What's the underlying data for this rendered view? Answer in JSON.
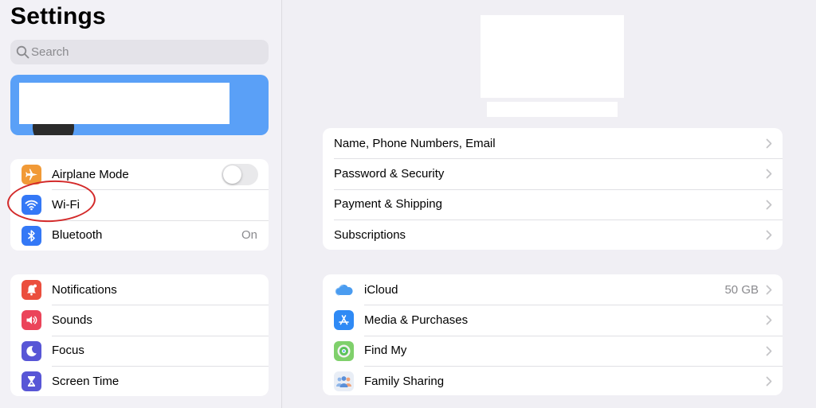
{
  "sidebar": {
    "title": "Settings",
    "search": {
      "placeholder": "Search",
      "value": ""
    },
    "group1": [
      {
        "label": "Airplane Mode",
        "icon": "airplane-icon",
        "color": "#f19a37"
      },
      {
        "label": "Wi-Fi",
        "icon": "wifi-icon",
        "color": "#3478f6"
      },
      {
        "label": "Bluetooth",
        "icon": "bluetooth-icon",
        "color": "#3478f6",
        "value": "On"
      }
    ],
    "group2": [
      {
        "label": "Notifications",
        "icon": "bell-icon",
        "color": "#eb4e3d"
      },
      {
        "label": "Sounds",
        "icon": "speaker-icon",
        "color": "#eb445a"
      },
      {
        "label": "Focus",
        "icon": "moon-icon",
        "color": "#5856d6"
      },
      {
        "label": "Screen Time",
        "icon": "hourglass-icon",
        "color": "#5856d6"
      }
    ]
  },
  "main": {
    "group1": [
      {
        "label": "Name, Phone Numbers, Email"
      },
      {
        "label": "Password & Security"
      },
      {
        "label": "Payment & Shipping"
      },
      {
        "label": "Subscriptions"
      }
    ],
    "group2": [
      {
        "label": "iCloud",
        "icon": "icloud-icon",
        "value": "50 GB"
      },
      {
        "label": "Media & Purchases",
        "icon": "app-store-icon"
      },
      {
        "label": "Find My",
        "icon": "find-my-icon"
      },
      {
        "label": "Family Sharing",
        "icon": "family-sharing-icon"
      }
    ]
  },
  "colors": {
    "accent": "#5aa0f7",
    "annotation": "#d32a2a",
    "secondary_text": "#8a8a8e"
  }
}
